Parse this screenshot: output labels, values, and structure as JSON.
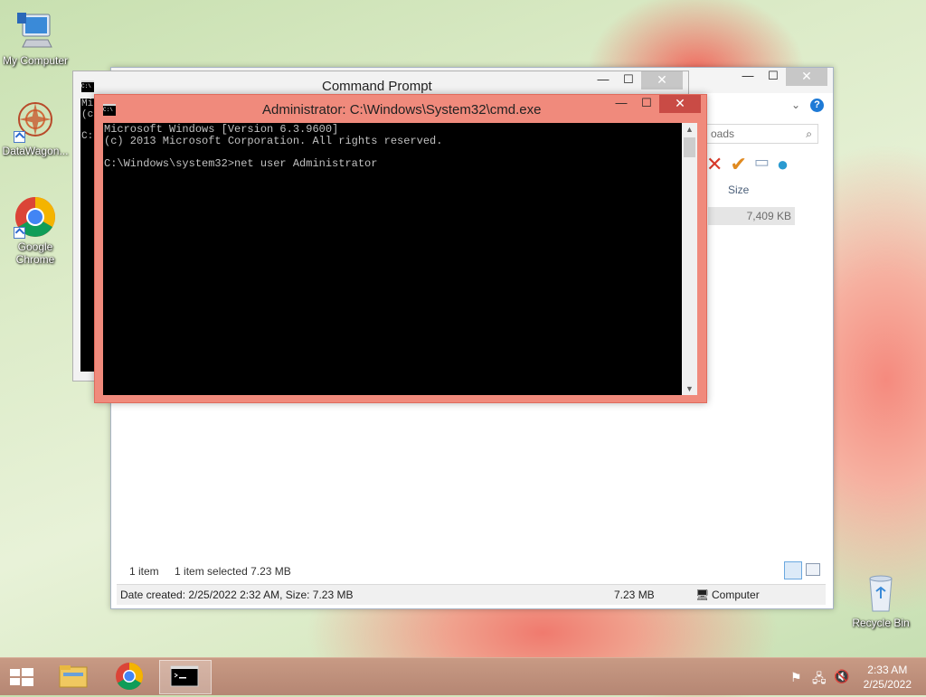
{
  "desktop": {
    "icons": [
      {
        "label": "My Computer"
      },
      {
        "label": "DataWagon..."
      },
      {
        "label": "Google Chrome"
      },
      {
        "label": "Recycle Bin"
      }
    ]
  },
  "explorer": {
    "search_placeholder": "oads",
    "column_size": "Size",
    "file_size": "7,409 KB",
    "status_items": "1 item",
    "status_selected": "1 item selected  7.23 MB",
    "info_created": "Date created: 2/25/2022 2:32 AM, Size: 7.23 MB",
    "info_size": "7.23 MB",
    "info_location": "Computer"
  },
  "cmd_back": {
    "title": "Command Prompt",
    "lines": [
      "Mi",
      "(c",
      "",
      "C:"
    ]
  },
  "cmd_admin": {
    "title": "Administrator: C:\\Windows\\System32\\cmd.exe",
    "console_text": "Microsoft Windows [Version 6.3.9600]\n(c) 2013 Microsoft Corporation. All rights reserved.\n\nC:\\Windows\\system32>net user Administrator"
  },
  "window_buttons": {
    "minimize": "—",
    "maximize": "☐",
    "close": "✕"
  },
  "taskbar": {
    "time": "2:33 AM",
    "date": "2/25/2022"
  },
  "colors": {
    "cmd_admin_frame": "#f08a7c",
    "taskbar": "#b58673"
  }
}
